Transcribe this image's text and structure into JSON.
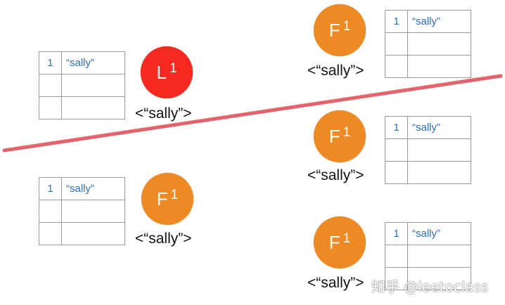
{
  "partition_color": "#e2505a",
  "colors": {
    "leader": "#f5291f",
    "follower": "#ee8a24",
    "log_text": "#2f6fb5"
  },
  "nodes": [
    {
      "role": "L",
      "term": "1",
      "value_label": "<“sally”>",
      "log": [
        [
          "1",
          "“sally”"
        ],
        [
          "",
          ""
        ],
        [
          "",
          ""
        ]
      ]
    },
    {
      "role": "F",
      "term": "1",
      "value_label": "<“sally”>",
      "log": [
        [
          "1",
          "“sally”"
        ],
        [
          "",
          ""
        ],
        [
          "",
          ""
        ]
      ]
    },
    {
      "role": "F",
      "term": "1",
      "value_label": "<“sally”>",
      "log": [
        [
          "1",
          "“sally”"
        ],
        [
          "",
          ""
        ],
        [
          "",
          ""
        ]
      ]
    },
    {
      "role": "F",
      "term": "1",
      "value_label": "<“sally”>",
      "log": [
        [
          "1",
          "“sally”"
        ],
        [
          "",
          ""
        ],
        [
          "",
          ""
        ]
      ]
    },
    {
      "role": "F",
      "term": "1",
      "value_label": "<“sally”>",
      "log": [
        [
          "1",
          "“sally”"
        ],
        [
          "",
          ""
        ],
        [
          "",
          ""
        ]
      ]
    }
  ],
  "watermark": "知乎 @leetoclass"
}
